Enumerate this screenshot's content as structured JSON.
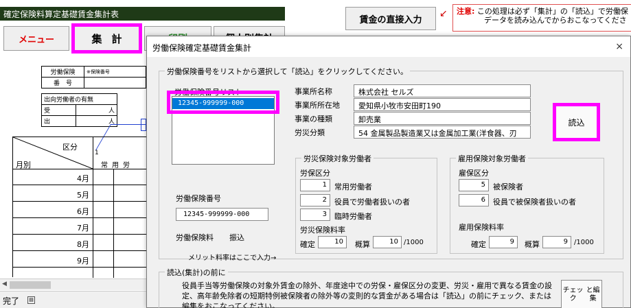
{
  "sheet": {
    "title": "確定保険料算定基礎賃金集計表",
    "buttons": {
      "menu": "メニュー",
      "shukei": "集計",
      "insatsu": "印刷",
      "kojin": "個人別集計",
      "chokusetsu": "賃金の直接入力"
    },
    "note": {
      "label": "注意:",
      "line1": "この処理は必ず「集計」の「読込」で労働保",
      "line2": "データを読み込んでからおこなってくださ"
    },
    "rodo_table": {
      "label1": "労働保険",
      "label2": "番　号",
      "value": "※保険番号"
    },
    "shukko_table": {
      "header": "出向労働者の有無",
      "uke": "受",
      "de": "出",
      "unit": "人"
    },
    "grid": {
      "kubun": "区分",
      "tsukibetsu": "月別",
      "col_num": "1",
      "joyo": "常用労",
      "months": [
        "4月",
        "5月",
        "6月",
        "7月",
        "8月",
        "9月"
      ]
    },
    "status": {
      "text": "完了"
    }
  },
  "dialog": {
    "title": "労働保険確定基礎賃金集計",
    "close": "×",
    "main_group": "労働保険番号をリストから選択して「読込」をクリックしてください。",
    "list_label": "労働保険番号リスト",
    "list_items": [
      "12345-999999-000"
    ],
    "info": {
      "name_label": "事業所名称",
      "name_value": "株式会社 セルズ",
      "address_label": "事業所所在地",
      "address_value": "愛知県小牧市安田町190",
      "type_label": "事業の種類",
      "type_value": "卸売業",
      "class_label": "労災分類",
      "class_value": "54 金属製品製造業又は金属加工業(洋食器、刃"
    },
    "read_button": "読込",
    "bangou_label": "労働保険番号",
    "bangou_value": "12345-999999-000",
    "ryo_label": "労働保険料",
    "furikomi": "振込",
    "merit_label": "メリット料率はここで入力→",
    "rosai": {
      "title": "労災保険対象労働者",
      "kubun_label": "労保区分",
      "rows": [
        {
          "value": "1",
          "label": "常用労働者"
        },
        {
          "value": "2",
          "label": "役員で労働者扱いの者"
        },
        {
          "value": "3",
          "label": "臨時労働者"
        }
      ],
      "rate_label": "労災保険料率",
      "kakutei_label": "確定",
      "kakutei_value": "10",
      "gaisan_label": "概算",
      "gaisan_value": "10",
      "unit": "/1000"
    },
    "koyo": {
      "title": "雇用保険対象労働者",
      "kubun_label": "雇保区分",
      "rows": [
        {
          "value": "5",
          "label": "被保険者"
        },
        {
          "value": "6",
          "label": "役員で被保険者扱いの者"
        }
      ],
      "rate_label": "雇用保険料率",
      "kakutei_label": "確定",
      "kakutei_value": "9",
      "gaisan_label": "概算",
      "gaisan_value": "9",
      "unit": "/1000"
    },
    "before_group": "読込(集計)の前に",
    "before_text": "役員手当等労働保険の対象外賃金の除外、年度途中での労保・雇保区分の変更、労災・雇用で異なる賃金の設定、高年齢免除者の短期特例被保険者の除外等の変則的な賃金がある場合は「読込」の前にチェック、または編集をおこなってください。",
    "check_button_line1": "チェック",
    "check_button_line2": "と編集"
  }
}
